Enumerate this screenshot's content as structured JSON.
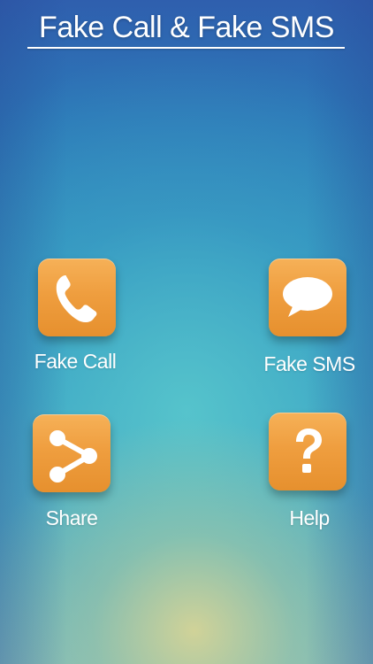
{
  "header": {
    "title": "Fake Call & Fake SMS"
  },
  "menu": {
    "fake_call": {
      "label": "Fake Call",
      "icon": "phone-icon"
    },
    "fake_sms": {
      "label": "Fake SMS",
      "icon": "chat-bubble-icon"
    },
    "share": {
      "label": "Share",
      "icon": "share-icon"
    },
    "help": {
      "label": "Help",
      "icon": "question-mark-icon"
    }
  },
  "colors": {
    "tile_orange": "#ef9e3f",
    "text": "#ffffff",
    "background_top": "#2f5fae",
    "background_mid": "#3aa8c4",
    "background_bottom_glow": "#d6d496"
  }
}
